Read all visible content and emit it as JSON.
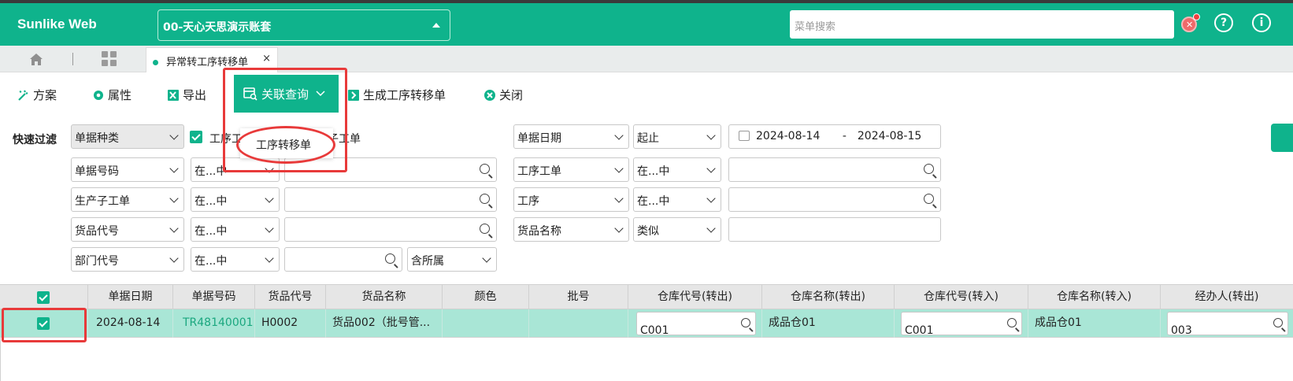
{
  "header": {
    "brand": "Sunlike Web",
    "account": "00-天心天思演示账套",
    "search_placeholder": "菜单搜索"
  },
  "tabs": {
    "active_label": "异常转工序转移单",
    "close": "×"
  },
  "toolbar": {
    "plan": "方案",
    "properties": "属性",
    "export": "导出",
    "related_query": "关联查询",
    "generate": "生成工序转移单",
    "close": "关闭"
  },
  "dropdown": {
    "item": "工序转移单"
  },
  "filters": {
    "quick_filter": "快速过滤",
    "doc_type": "单据种类",
    "checkbox_label_left": "工序工",
    "checkbox_label_right": "子工单",
    "doc_no": "单据号码",
    "op_in": "在...中",
    "prod_sub_order": "生产子工单",
    "item_code": "货品代号",
    "dept_code": "部门代号",
    "include_sub": "含所属",
    "doc_date": "单据日期",
    "range": "起止",
    "date_from": "2024-08-14",
    "date_sep": "-",
    "date_to": "2024-08-15",
    "proc_order": "工序工单",
    "process": "工序",
    "item_name": "货品名称",
    "like": "类似"
  },
  "table": {
    "headers": [
      "单据日期",
      "单据号码",
      "货品代号",
      "货品名称",
      "颜色",
      "批号",
      "仓库代号(转出)",
      "仓库名称(转出)",
      "仓库代号(转入)",
      "仓库名称(转入)",
      "经办人(转出)"
    ],
    "row": {
      "date": "2024-08-14",
      "doc_no": "TR48140001",
      "item_code": "H0002",
      "item_name": "货品002（批号管...",
      "color": "",
      "batch": "",
      "wh_out_code": "C001",
      "wh_out_name": "成品仓01",
      "wh_in_code": "C001",
      "wh_in_name": "成品仓01",
      "handler_out": "003"
    }
  }
}
